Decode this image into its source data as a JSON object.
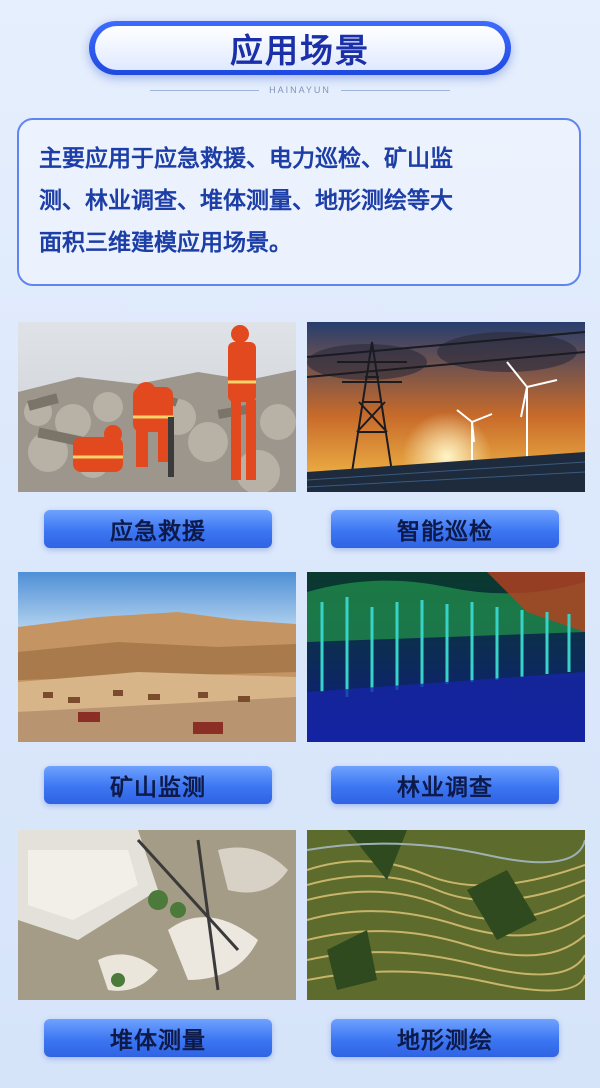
{
  "header": {
    "title": "应用场景",
    "brand": "HAINAYUN"
  },
  "description": {
    "lines": [
      "主要应用于应急救援、电力巡检、矿山监",
      "测、林业调查、堆体测量、地形测绘等大",
      "面积三维建模应用场景。"
    ]
  },
  "scenes": [
    {
      "label": "应急救援"
    },
    {
      "label": "智能巡检"
    },
    {
      "label": "矿山监测"
    },
    {
      "label": "林业调查"
    },
    {
      "label": "堆体测量"
    },
    {
      "label": "地形测绘"
    }
  ]
}
